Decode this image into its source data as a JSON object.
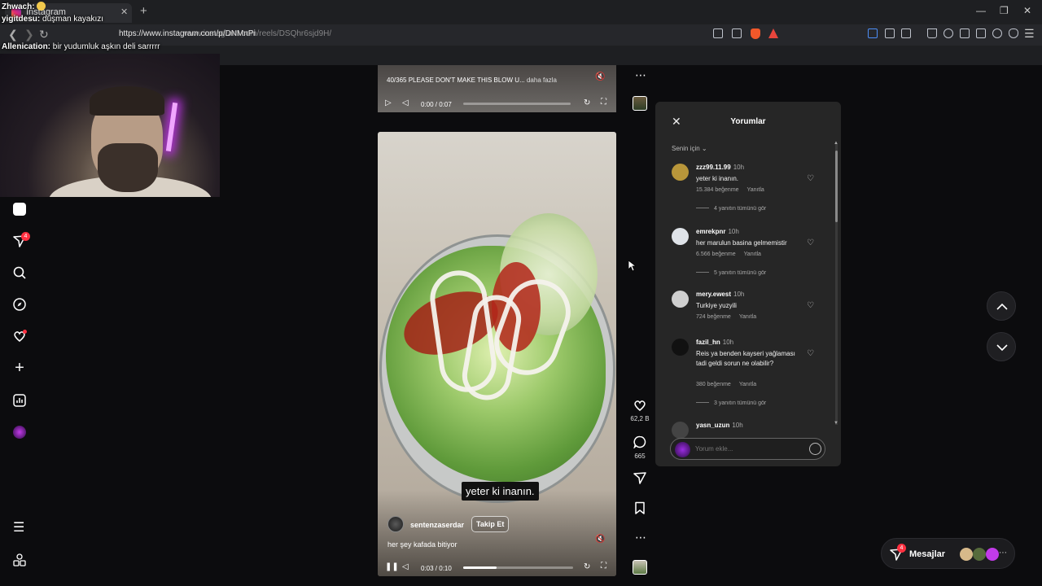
{
  "browser": {
    "tab_title": "Instagram",
    "url": "https://www.instagram.com/p/DNMnPi",
    "url_ghost": "www.instagram.com/reels/DSQhr6sjd9H/"
  },
  "chat": [
    {
      "user": "Zhwach:",
      "text": ""
    },
    {
      "user": "yigitdesu:",
      "text": " düşman kayakızı"
    },
    {
      "user": "Allenication:",
      "text": " bir yudumluk aşkın deli sarrrrr"
    }
  ],
  "nav": {
    "notifications_badge": "4"
  },
  "reel_top": {
    "caption": "40/365 PLEASE DON'T MAKE THIS BLOW U... ",
    "more": "daha fazla",
    "time": "0:00 / 0:07"
  },
  "reel": {
    "subtitle": "yeter ki inanın.",
    "author": "sentenzaserdar",
    "follow": "Takip Et",
    "caption": "her şey kafada bitiyor",
    "time": "0:03 / 0:10",
    "progress": 0.3
  },
  "actions": {
    "likes": "62,2 B",
    "comments": "665"
  },
  "comments_panel": {
    "title": "Yorumlar",
    "filter": "Senin için",
    "reply_label": "Yanıtla",
    "input_placeholder": "Yorum ekle...",
    "items": [
      {
        "user": "zzz99.11.99",
        "time": "10h",
        "text": "yeter ki inanın.",
        "likes": "15.384 beğenme",
        "replies": "4 yanıtın tümünü gör",
        "avatar_color": "#b8963a"
      },
      {
        "user": "emrekpnr",
        "time": "10h",
        "text": "her marulun basina gelmemistir",
        "likes": "6.566 beğenme",
        "replies": "5 yanıtın tümünü gör",
        "avatar_color": "#dfe3e8"
      },
      {
        "user": "mery.ewest",
        "time": "10h",
        "text": "Turkiye yuzyili",
        "likes": "724 beğenme",
        "replies": "",
        "avatar_color": "#cfcfcf"
      },
      {
        "user": "fazil_hn",
        "time": "10h",
        "text": "Reis ya benden kayseri yağlaması tadi geldi sorun ne olabilir?",
        "likes": "380 beğenme",
        "replies": "3 yanıtın tümünü gör",
        "avatar_color": "#111111"
      },
      {
        "user": "yasn_uzun",
        "time": "10h",
        "text": "",
        "likes": "",
        "replies": "",
        "avatar_color": "#444444"
      }
    ]
  },
  "messages": {
    "label": "Mesajlar",
    "badge": "4"
  },
  "colors": {
    "accent": "#ff3040",
    "panel": "#262626",
    "background": "#0c0c0e"
  }
}
